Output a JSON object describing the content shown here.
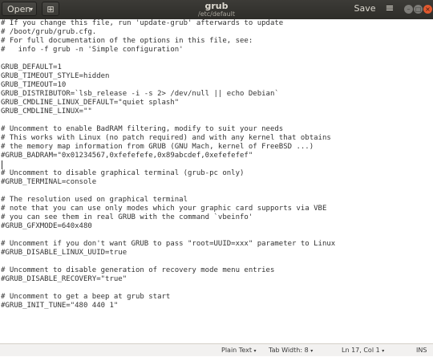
{
  "titlebar": {
    "open_label": "Open",
    "open_arrow": "▾",
    "pin_icon": "⊞",
    "title": "grub",
    "subtitle": "/etc/default",
    "save_label": "Save",
    "menu_icon": "≡",
    "minimize_icon": "–",
    "maximize_icon": "□",
    "close_icon": "×"
  },
  "editor": {
    "lines": [
      "# If you change this file, run 'update-grub' afterwards to update",
      "# /boot/grub/grub.cfg.",
      "# For full documentation of the options in this file, see:",
      "#   info -f grub -n 'Simple configuration'",
      "",
      "GRUB_DEFAULT=1",
      "GRUB_TIMEOUT_STYLE=hidden",
      "GRUB_TIMEOUT=10",
      "GRUB_DISTRIBUTOR=`lsb_release -i -s 2> /dev/null || echo Debian`",
      "GRUB_CMDLINE_LINUX_DEFAULT=\"quiet splash\"",
      "GRUB_CMDLINE_LINUX=\"\"",
      "",
      "# Uncomment to enable BadRAM filtering, modify to suit your needs",
      "# This works with Linux (no patch required) and with any kernel that obtains",
      "# the memory map information from GRUB (GNU Mach, kernel of FreeBSD ...)",
      "#GRUB_BADRAM=\"0x01234567,0xfefefefe,0x89abcdef,0xefefefef\"",
      "",
      "# Uncomment to disable graphical terminal (grub-pc only)",
      "#GRUB_TERMINAL=console",
      "",
      "# The resolution used on graphical terminal",
      "# note that you can use only modes which your graphic card supports via VBE",
      "# you can see them in real GRUB with the command `vbeinfo'",
      "#GRUB_GFXMODE=640x480",
      "",
      "# Uncomment if you don't want GRUB to pass \"root=UUID=xxx\" parameter to Linux",
      "#GRUB_DISABLE_LINUX_UUID=true",
      "",
      "# Uncomment to disable generation of recovery mode menu entries",
      "#GRUB_DISABLE_RECOVERY=\"true\"",
      "",
      "# Uncomment to get a beep at grub start",
      "#GRUB_INIT_TUNE=\"480 440 1\""
    ]
  },
  "statusbar": {
    "language": "Plain Text",
    "tab_width": "Tab Width: 8",
    "position": "Ln 17, Col 1",
    "mode": "INS",
    "dropdown_arrow": "▾"
  }
}
